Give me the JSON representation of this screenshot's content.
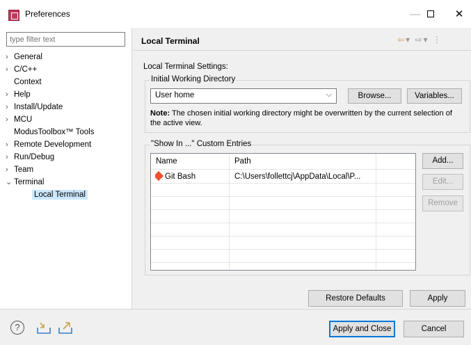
{
  "window": {
    "title": "Preferences",
    "minimize": "—",
    "close": "✕"
  },
  "sidebar": {
    "filter_placeholder": "type filter text",
    "items": [
      {
        "label": "General",
        "arrow": "›"
      },
      {
        "label": "C/C++",
        "arrow": "›"
      },
      {
        "label": "Context",
        "arrow": ""
      },
      {
        "label": "Help",
        "arrow": "›"
      },
      {
        "label": "Install/Update",
        "arrow": "›"
      },
      {
        "label": "MCU",
        "arrow": "›"
      },
      {
        "label": "ModusToolbox™ Tools",
        "arrow": ""
      },
      {
        "label": "Remote Development",
        "arrow": "›"
      },
      {
        "label": "Run/Debug",
        "arrow": "›"
      },
      {
        "label": "Team",
        "arrow": "›"
      },
      {
        "label": "Terminal",
        "arrow": "⌄"
      },
      {
        "label": "Local Terminal",
        "arrow": ""
      }
    ]
  },
  "page": {
    "title": "Local Terminal",
    "settings_label": "Local Terminal Settings:",
    "working_dir": {
      "group_title": "Initial Working Directory",
      "value": "User home",
      "browse": "Browse...",
      "variables": "Variables...",
      "note_label": "Note:",
      "note_text": "The chosen initial working directory might be overwritten by the current selection of the active view."
    },
    "custom_entries": {
      "group_title": "\"Show In ...\" Custom Entries",
      "columns": [
        "Name",
        "Path"
      ],
      "rows": [
        {
          "name": "Git Bash",
          "path": "C:\\Users\\follettcj\\AppData\\Local\\P..."
        }
      ],
      "add": "Add...",
      "edit": "Edit...",
      "remove": "Remove"
    },
    "restore_defaults": "Restore Defaults",
    "apply": "Apply"
  },
  "footer": {
    "apply_close": "Apply and Close",
    "cancel": "Cancel",
    "help_icon_glyph": "?"
  },
  "colors": {
    "selection": "#cce8ff",
    "accent": "#0078d7",
    "nav_arrow": "#c8a34a"
  }
}
